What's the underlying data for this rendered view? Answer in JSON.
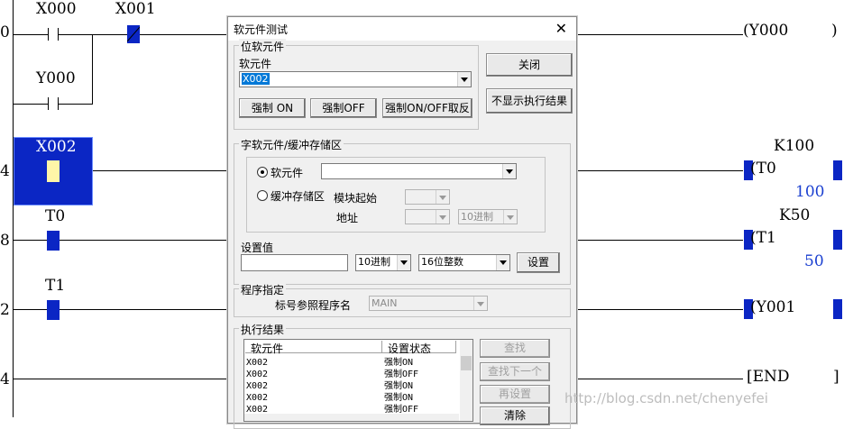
{
  "ladder": {
    "steps": [
      "0",
      "4",
      "8",
      "2",
      "4"
    ],
    "contacts": {
      "x000": "X000",
      "x001": "X001",
      "y000_contact": "Y000",
      "x002": "X002",
      "t0": "T0",
      "t1": "T1"
    },
    "coils": {
      "y000": "(Y000",
      "t0": "(T0",
      "t0_const": "K100",
      "t0_value": "100",
      "t1": "(T1",
      "t1_const": "K50",
      "t1_value": "50",
      "y001": "(Y001",
      "end": "[END"
    }
  },
  "dialog": {
    "title": "软元件测试",
    "close_glyph": "✕",
    "bit_group": {
      "title": "位软元件",
      "device_label": "软元件",
      "device_value": "X002",
      "force_on": "强制 ON",
      "force_off": "强制OFF",
      "force_toggle": "强制ON/OFF取反"
    },
    "close_button": "关闭",
    "hide_results_button": "不显示执行结果",
    "word_group": {
      "title": "字软元件/缓冲存储区",
      "device_radio": "软元件",
      "buffer_radio": "缓冲存储区",
      "module_start": "模块起始",
      "address": "地址",
      "address_format": "10进制"
    },
    "set_value": {
      "label": "设置值",
      "format": "10进制",
      "type": "16位整数",
      "set_button": "设置"
    },
    "program": {
      "title": "程序指定",
      "label": "标号参照程序名",
      "value": "MAIN"
    },
    "results": {
      "title": "执行结果",
      "col_device": "软元件",
      "col_state": "设置状态",
      "rows": [
        {
          "device": "X002",
          "state": "强制ON"
        },
        {
          "device": "X002",
          "state": "强制OFF"
        },
        {
          "device": "X002",
          "state": "强制ON"
        },
        {
          "device": "X002",
          "state": "强制ON"
        },
        {
          "device": "X002",
          "state": "强制OFF"
        }
      ],
      "find_button": "查找",
      "find_next_button": "查找下一个",
      "reset_button": "再设置",
      "clear_button": "清除"
    }
  },
  "watermark": "http://blog.csdn.net/chenyefei",
  "colors": {
    "cursor_blue": "#0b26c4",
    "value_blue": "#1a3fd0",
    "selection": "#0078d7"
  }
}
